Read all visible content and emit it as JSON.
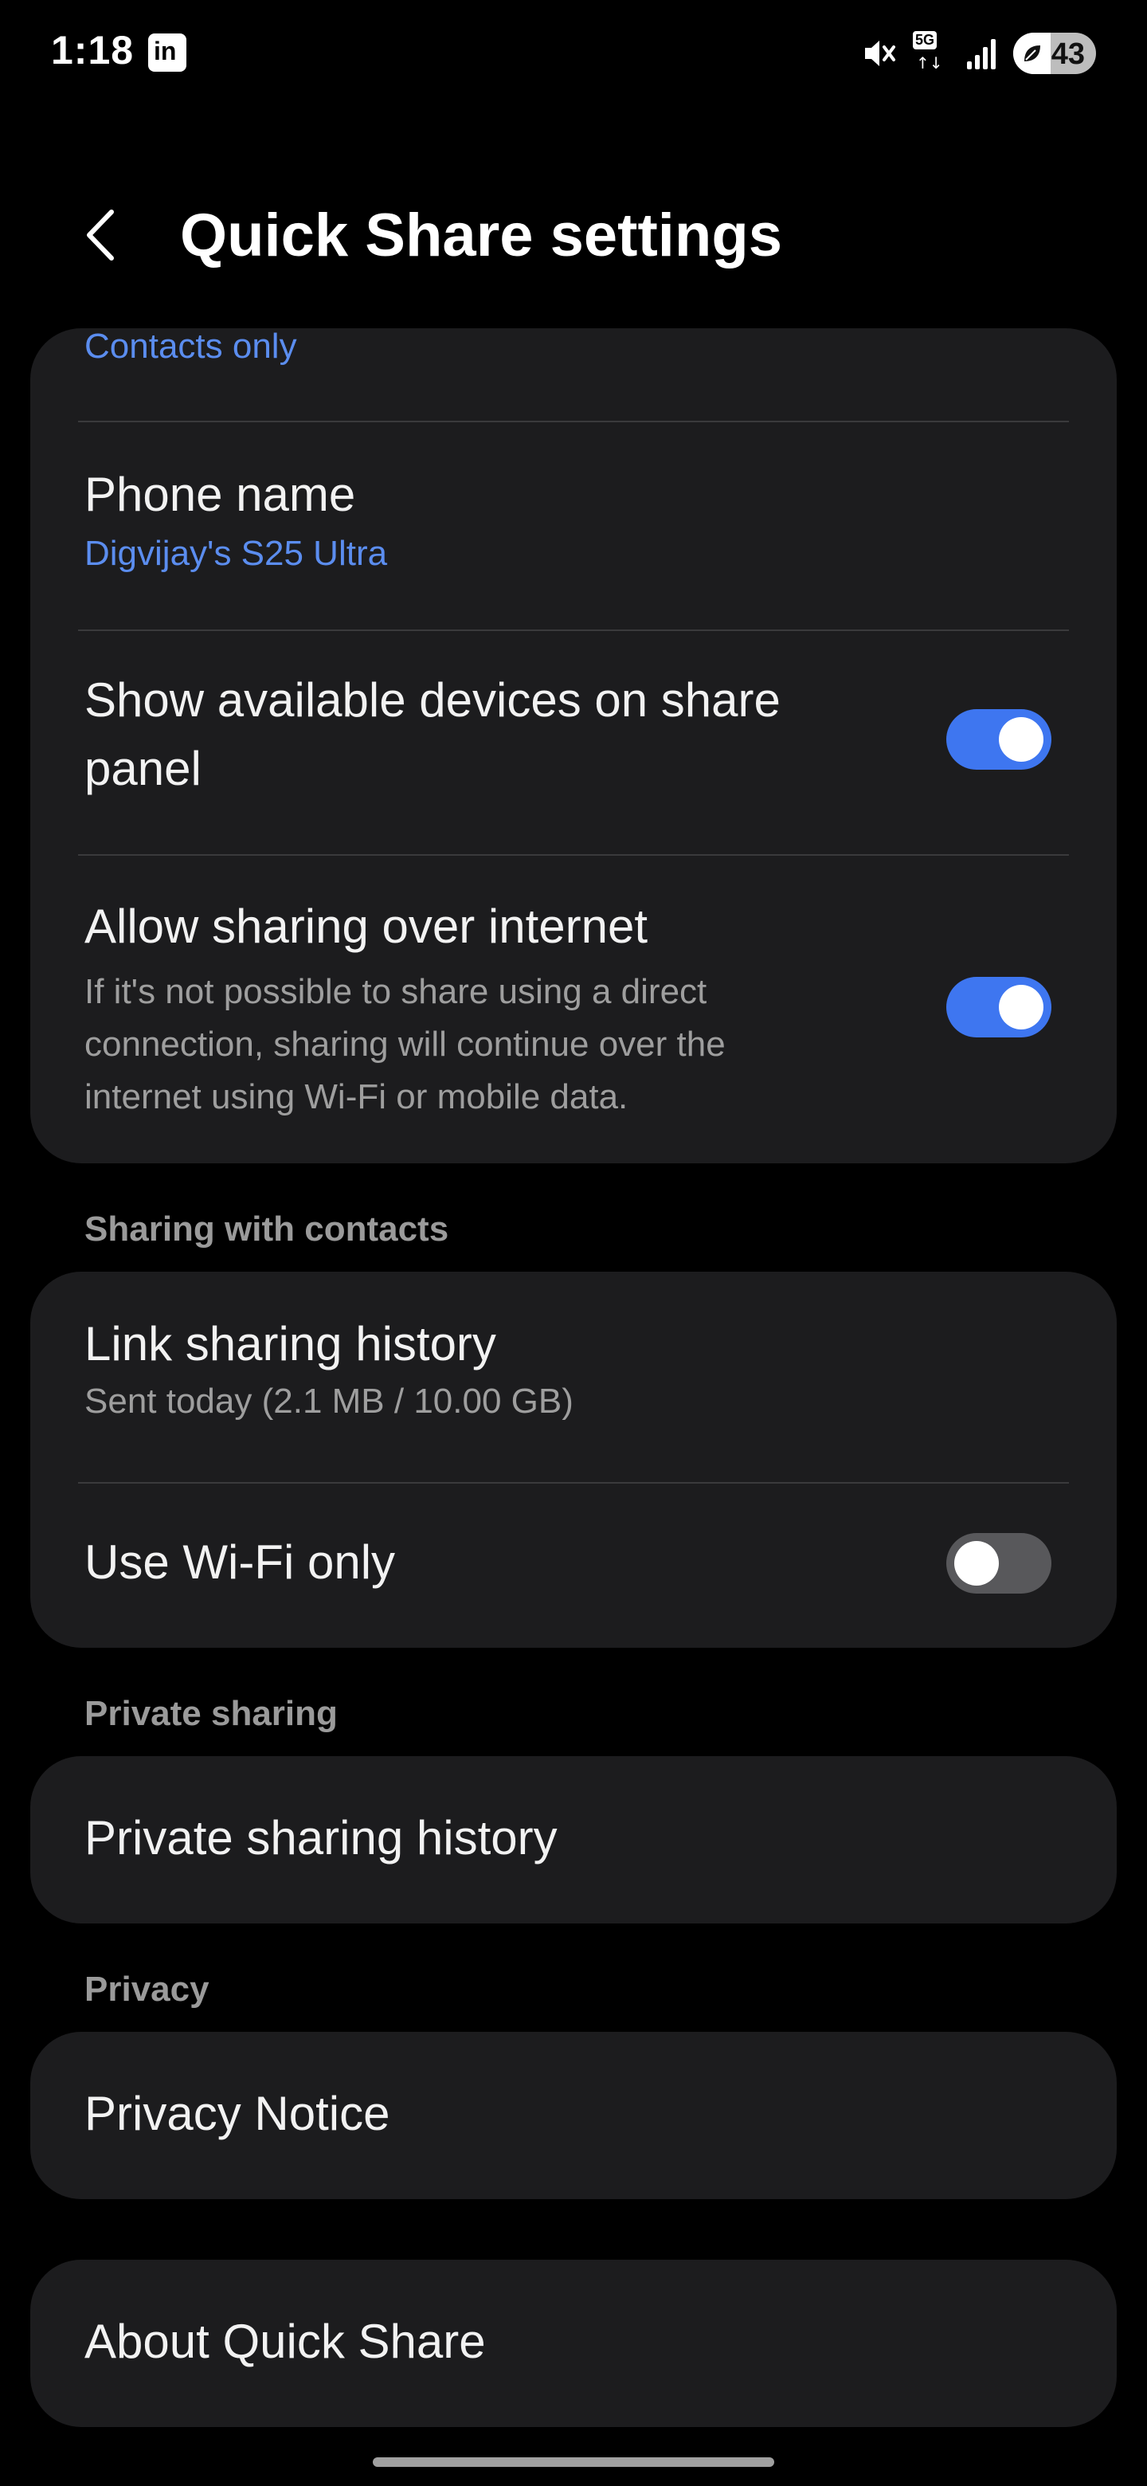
{
  "status_bar": {
    "time": "1:18",
    "notification_icon": "linkedin-icon",
    "network": "5G",
    "battery_percent": "43"
  },
  "header": {
    "title": "Quick Share settings"
  },
  "main_card": {
    "visibility_value": "Contacts only",
    "phone_name_title": "Phone name",
    "phone_name_value": "Digvijay's S25 Ultra",
    "show_devices_title_line1": "Show available devices on share",
    "show_devices_title_line2": "panel",
    "show_devices_enabled": true,
    "internet_title": "Allow sharing over internet",
    "internet_desc_line1": "If it's not possible to share using a direct",
    "internet_desc_line2": "connection, sharing will continue over the",
    "internet_desc_line3": "internet using Wi-Fi or mobile data.",
    "internet_enabled": true
  },
  "contacts_section": {
    "header": "Sharing with contacts",
    "link_history_title": "Link sharing history",
    "link_history_sub": "Sent today (2.1 MB / 10.00 GB)",
    "wifi_only_title": "Use Wi-Fi only",
    "wifi_only_enabled": false
  },
  "private_section": {
    "header": "Private sharing",
    "history_title": "Private sharing history"
  },
  "privacy_section": {
    "header": "Privacy",
    "notice_title": "Privacy Notice"
  },
  "about": {
    "title": "About Quick Share"
  },
  "colors": {
    "background": "#000000",
    "card": "#1c1c1e",
    "accent_blue": "#5b8def",
    "toggle_on": "#3e76f0",
    "toggle_off": "#58585b"
  }
}
